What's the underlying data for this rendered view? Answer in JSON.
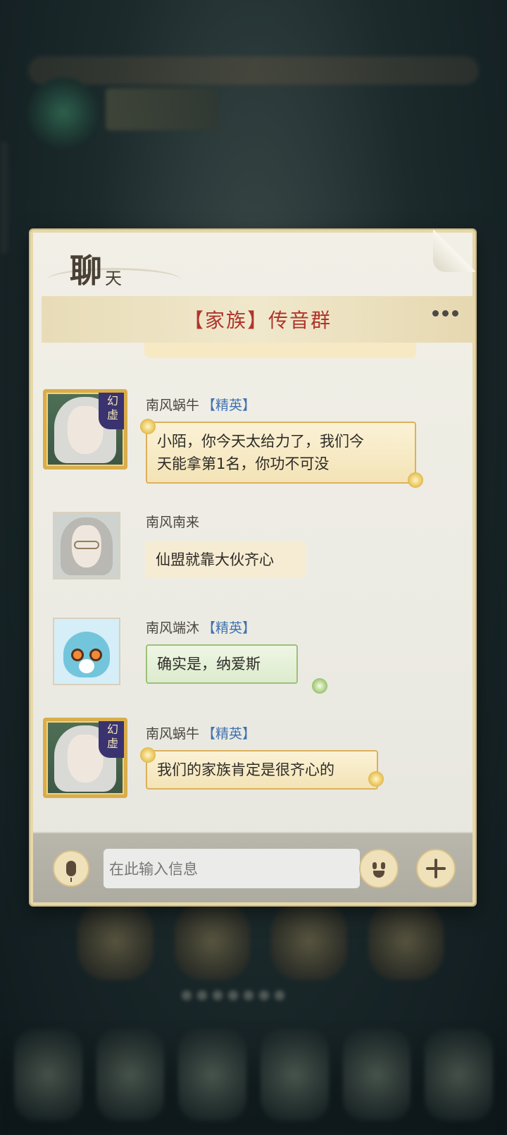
{
  "panel": {
    "title_main": "聊",
    "title_sub": "天"
  },
  "group_header": {
    "title": "【家族】传音群",
    "more_icon": "more-dots-icon"
  },
  "messages": [
    {
      "sender": "南风蜗牛",
      "rank": "【精英】",
      "badge": [
        "幻",
        "虚"
      ],
      "avatar": "gold-frame-elf-avatar",
      "style": "gold",
      "text_lines": [
        "小陌，你今天太给力了，我们今",
        "天能拿第1名，你功不可没"
      ]
    },
    {
      "sender": "南风南来",
      "rank": "",
      "avatar": "silver-hair-glasses-avatar",
      "style": "plain",
      "text_lines": [
        "仙盟就靠大伙齐心"
      ]
    },
    {
      "sender": "南风端沐",
      "rank": "【精英】",
      "avatar": "blue-pet-avatar",
      "style": "green",
      "text_lines": [
        "确实是，纳爱斯"
      ]
    },
    {
      "sender": "南风蜗牛",
      "rank": "【精英】",
      "badge": [
        "幻",
        "虚"
      ],
      "avatar": "gold-frame-elf-avatar",
      "style": "gold",
      "text_lines": [
        "我们的家族肯定是很齐心的"
      ]
    }
  ],
  "input_bar": {
    "placeholder": "在此输入信息",
    "mic_icon": "microphone-icon",
    "emoji_icon": "emoji-face-icon",
    "plus_icon": "plus-icon"
  },
  "colors": {
    "header_title": "#b0342c",
    "rank": "#3f72b3",
    "gold_border": "#dcb15b",
    "green_border": "#9cc17a"
  }
}
